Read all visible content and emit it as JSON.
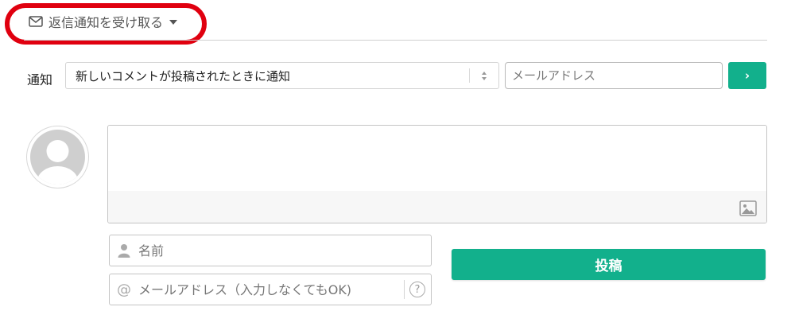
{
  "reply_notify": {
    "toggle_label": "返信通知を受け取る",
    "icon": "mail-icon",
    "highlight_color": "#e0000f"
  },
  "notify": {
    "label": "通知",
    "select_value": "新しいコメントが投稿されたときに通知",
    "email_placeholder": "メールアドレス",
    "submit_label": "›"
  },
  "comment": {
    "text_placeholder": "",
    "image_icon": "image-icon"
  },
  "author": {
    "name_placeholder": "名前",
    "email_placeholder": "メールアドレス（入力しなくてもOK)",
    "at_symbol": "@",
    "help_symbol": "?"
  },
  "post_button_label": "投稿",
  "colors": {
    "accent": "#12b08c",
    "highlight": "#e0000f",
    "avatar_gray": "#cfcfcf"
  }
}
